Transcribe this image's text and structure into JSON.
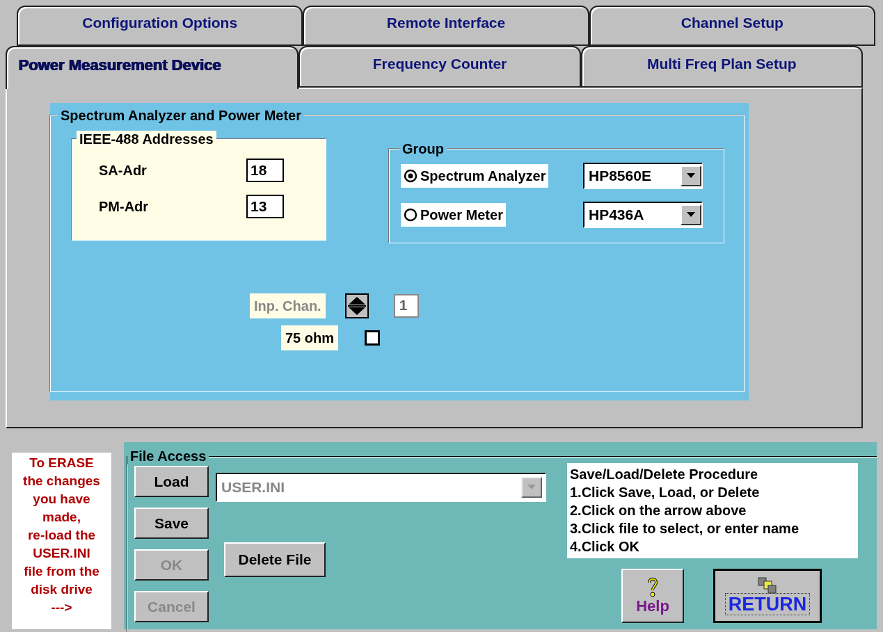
{
  "tab_rows": [
    {
      "tabs": [
        {
          "label": "Configuration Options",
          "selected": false
        },
        {
          "label": "Remote Interface",
          "selected": false
        },
        {
          "label": "Channel Setup",
          "selected": false
        }
      ]
    },
    {
      "tabs": [
        {
          "label": "Power Measurement Device",
          "selected": true
        },
        {
          "label": "Frequency Counter",
          "selected": false
        },
        {
          "label": "Multi Freq Plan Setup",
          "selected": false
        }
      ]
    }
  ],
  "section": {
    "title": "Spectrum Analyzer and Power Meter",
    "addresses": {
      "title": "IEEE-488 Addresses",
      "fields": [
        {
          "label": "SA-Adr",
          "value": "18"
        },
        {
          "label": "PM-Adr",
          "value": "13"
        }
      ]
    },
    "group": {
      "title": "Group",
      "options": [
        {
          "label": "Spectrum Analyzer",
          "selected": true,
          "device": "HP8560E"
        },
        {
          "label": "Power Meter",
          "selected": false,
          "device": "HP436A"
        }
      ]
    },
    "input_channel": {
      "label": "Inp. Chan.",
      "value": "1",
      "disabled": true
    },
    "impedance": {
      "label": "75 ohm",
      "checked": false
    }
  },
  "erase_note": "To ERASE\nthe changes\nyou have\nmade,\nre-load the\nUSER.INI\nfile from the\ndisk drive\n--->",
  "file_access": {
    "title": "File Access",
    "buttons": [
      {
        "label": "Load",
        "disabled": false
      },
      {
        "label": "Save",
        "disabled": false
      },
      {
        "label": "OK",
        "disabled": true
      },
      {
        "label": "Cancel",
        "disabled": true
      }
    ],
    "file": {
      "value": "USER.INI",
      "disabled": true
    },
    "delete_button": "Delete File",
    "procedure": {
      "title": "Save/Load/Delete Procedure",
      "steps": [
        "1.Click Save, Load, or Delete",
        "2.Click on the arrow above",
        "3.Click file to select, or enter name",
        "4.Click OK"
      ]
    },
    "help_button": "Help",
    "return_button": "RETURN"
  }
}
